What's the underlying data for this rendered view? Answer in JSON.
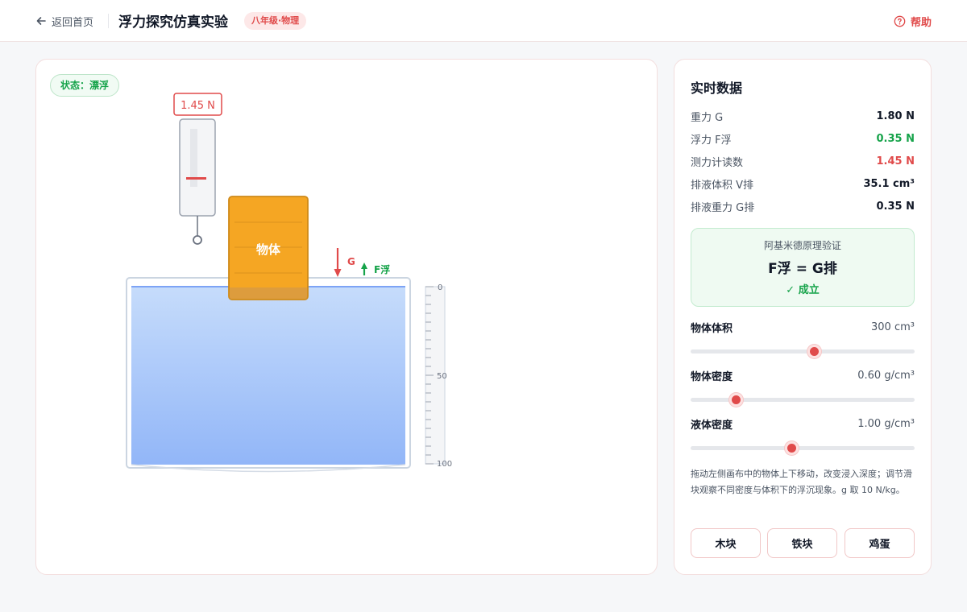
{
  "header": {
    "back_label": "返回首页",
    "title": "浮力探究仿真实验",
    "badge": "八年级·物理",
    "help_label": "帮助"
  },
  "canvas": {
    "status": "状态：漂浮",
    "meter_reading": "1.45 N",
    "object_label": "物体",
    "force_g_label": "G",
    "force_f_label": "F浮",
    "scale_labels": [
      "0",
      "50",
      "100"
    ],
    "submerged_fraction": 0.12
  },
  "panel": {
    "title": "实时数据",
    "rows": [
      {
        "label": "重力 G",
        "value": "1.80 N"
      },
      {
        "label": "浮力 F浮",
        "value": "0.35 N"
      },
      {
        "label": "测力计读数",
        "value": "1.45 N"
      },
      {
        "label": "排液体积 V排",
        "value": "35.1 cm³"
      },
      {
        "label": "排液重力 G排",
        "value": "0.35 N"
      }
    ],
    "verify": {
      "title": "阿基米德原理验证",
      "formula": "F浮 = G排",
      "result": "✓ 成立"
    },
    "sliders": [
      {
        "name": "物体体积",
        "value": "300",
        "unit": "cm³",
        "fraction": 0.55
      },
      {
        "name": "物体密度",
        "value": "0.60",
        "unit": "g/cm³",
        "fraction": 0.2
      },
      {
        "name": "液体密度",
        "value": "1.00",
        "unit": "g/cm³",
        "fraction": 0.45
      }
    ],
    "hint": "拖动左侧画布中的物体上下移动，改变浸入深度；调节滑块观察不同密度与体积下的浮沉现象。g 取 10 N/kg。",
    "presets": [
      "木块",
      "铁块",
      "鸡蛋"
    ]
  },
  "colors": {
    "accent": "#e04a4a",
    "success": "#16a34a",
    "object": "#f5a623",
    "water": "#a9c9fb"
  }
}
